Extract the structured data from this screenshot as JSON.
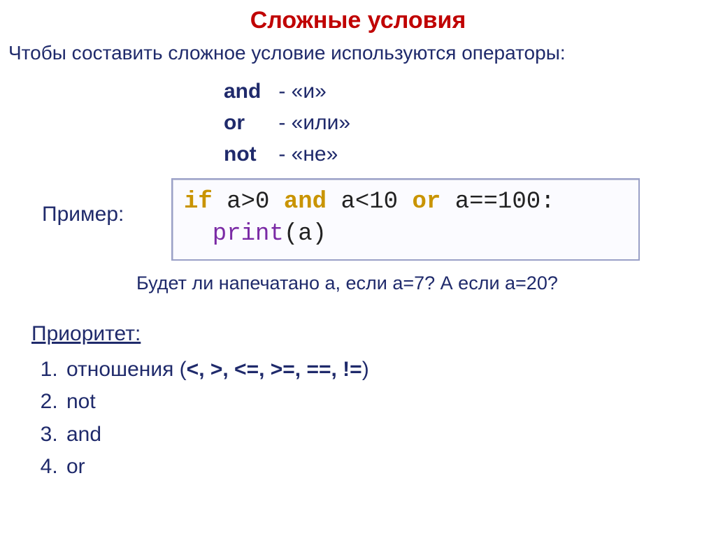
{
  "title": "Сложные условия",
  "intro": "Чтобы составить сложное условие используются операторы:",
  "operators": {
    "and_kw": "and",
    "and_desc": "- «и»",
    "or_kw": "or",
    "or_desc": "- «или»",
    "not_kw": "not",
    "not_desc": "- «не»"
  },
  "example_label": "Пример:",
  "code": {
    "if_kw": "if",
    "expr1": " a>0 ",
    "and_kw": "and",
    "expr2": " a<10 ",
    "or_kw": "or",
    "expr3": " a==100:",
    "print_fn": "print",
    "print_arg": "(a)"
  },
  "question": "Будет ли напечатано а, если а=7? А если а=20?",
  "priority": {
    "heading": "Приоритет:",
    "items": {
      "i1_prefix": "отношения (",
      "i1_ops": "<, >, <=, >=, ==, !=",
      "i1_suffix": ")",
      "i2": "not",
      "i3": "and",
      "i4": "or"
    }
  }
}
